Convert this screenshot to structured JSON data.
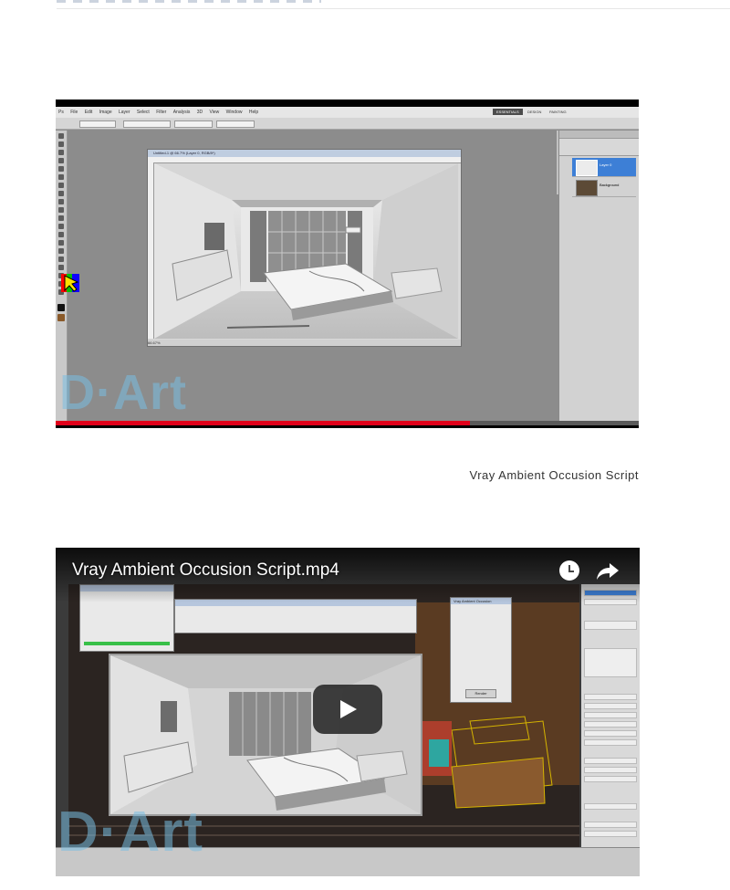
{
  "video1": {
    "title": "Untitled-1 @ 66.7% (Layer 0, RGB/8*)",
    "menu": [
      "Ps",
      "File",
      "Edit",
      "Image",
      "Layer",
      "Select",
      "Filter",
      "Analysis",
      "3D",
      "View",
      "Window",
      "Help"
    ],
    "workspace": "ESSENTIALS",
    "workspace_alt": [
      "DESIGN",
      "PAINTING"
    ],
    "status": "66.67%",
    "layers": [
      "Layer 0",
      "Background"
    ],
    "progress": 0.71,
    "watermark": "D·Art"
  },
  "caption": "Vray Ambient Occusion Script",
  "video2": {
    "title": "Vray Ambient Occusion Script.mp4",
    "icons": [
      "watch-later-icon",
      "share-icon",
      "play-icon"
    ],
    "watermark": "D·Art",
    "dialog_title": "Vray Ambient Occusion",
    "dialog_button": "Render"
  },
  "colors": {
    "progress_red": "#e1001a",
    "watermark": "#78bee1",
    "ps_layer_selected": "#3d7fd6"
  }
}
